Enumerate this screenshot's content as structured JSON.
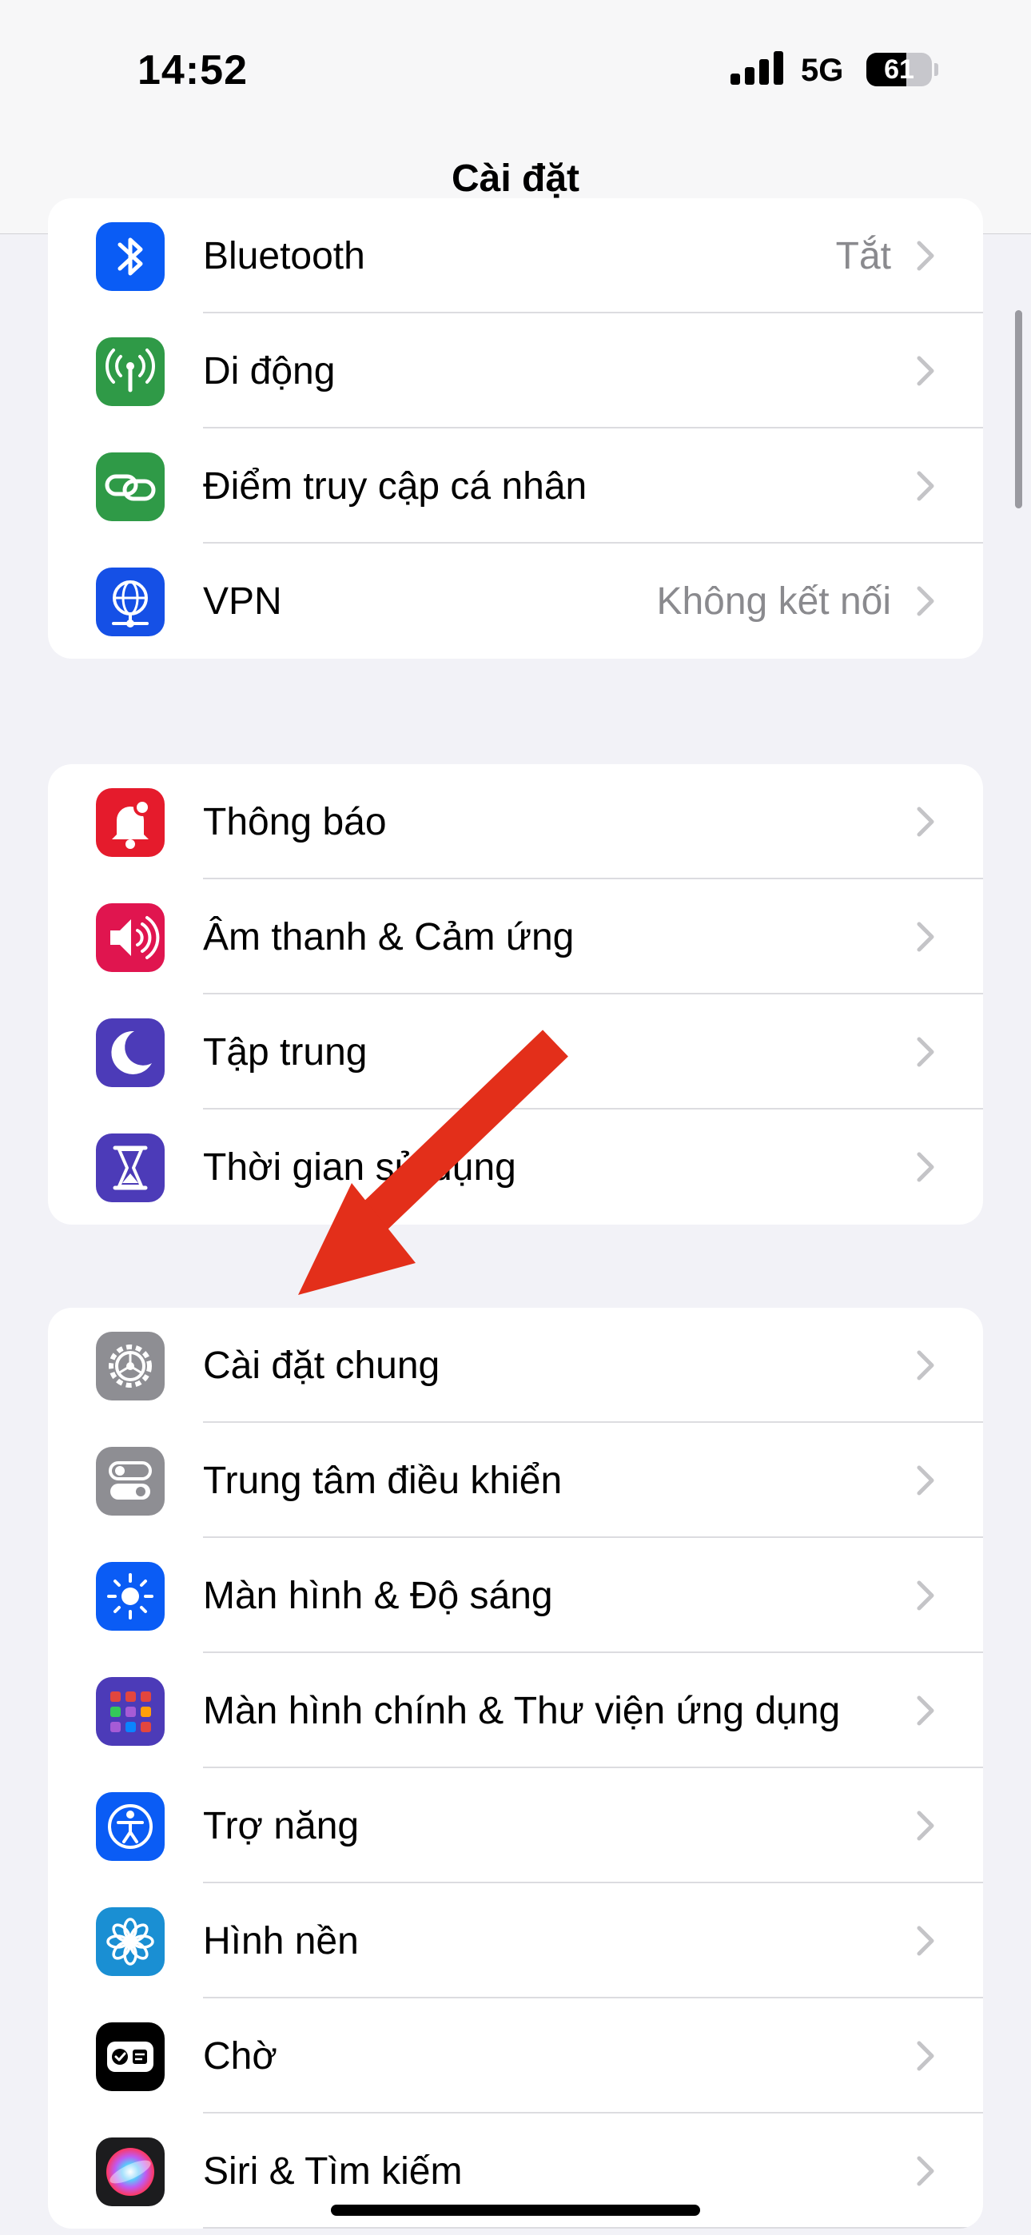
{
  "status_bar": {
    "time": "14:52",
    "network": "5G",
    "battery_level": "61",
    "battery_fraction": 0.61
  },
  "nav": {
    "title": "Cài đặt"
  },
  "colors": {
    "background": "#f2f2f7",
    "chevron": "#c4c4c7",
    "value_text": "#8a8a8e",
    "annotation_arrow": "#e32f1a"
  },
  "groups": [
    {
      "rows": [
        {
          "label": "Bluetooth",
          "value": "Tắt",
          "icon": "bluetooth-icon",
          "color": "#0a5cf5"
        },
        {
          "label": "Di động",
          "value": "",
          "icon": "cellular-icon",
          "color": "#2f9a47"
        },
        {
          "label": "Điểm truy cập cá nhân",
          "value": "",
          "icon": "hotspot-icon",
          "color": "#2f9a47"
        },
        {
          "label": "VPN",
          "value": "Không kết nối",
          "icon": "vpn-globe-icon",
          "color": "#1550e6"
        }
      ]
    },
    {
      "rows": [
        {
          "label": "Thông báo",
          "value": "",
          "icon": "notifications-bell-icon",
          "color": "#e51b2c"
        },
        {
          "label": "Âm thanh & Cảm ứng",
          "value": "",
          "icon": "speaker-icon",
          "color": "#e0154f"
        },
        {
          "label": "Tập trung",
          "value": "",
          "icon": "moon-icon",
          "color": "#4c3bb8"
        },
        {
          "label": "Thời gian sử dụng",
          "value": "",
          "icon": "hourglass-icon",
          "color": "#4c3bb8"
        }
      ]
    },
    {
      "rows": [
        {
          "label": "Cài đặt chung",
          "value": "",
          "icon": "gear-icon",
          "color": "#8e8e93"
        },
        {
          "label": "Trung tâm điều khiển",
          "value": "",
          "icon": "toggles-icon",
          "color": "#8e8e93"
        },
        {
          "label": "Màn hình & Độ sáng",
          "value": "",
          "icon": "sun-icon",
          "color": "#0a5cf5"
        },
        {
          "label": "Màn hình chính & Thư viện ứng dụng",
          "value": "",
          "icon": "app-grid-icon",
          "color": "#4c3bb8"
        },
        {
          "label": "Trợ năng",
          "value": "",
          "icon": "accessibility-icon",
          "color": "#0a5cf5"
        },
        {
          "label": "Hình nền",
          "value": "",
          "icon": "flower-icon",
          "color": "#1a8fd3"
        },
        {
          "label": "Chờ",
          "value": "",
          "icon": "standby-icon",
          "color": "#000000"
        },
        {
          "label": "Siri & Tìm kiếm",
          "value": "",
          "icon": "siri-icon",
          "color": "#1c1c1e"
        }
      ]
    }
  ]
}
